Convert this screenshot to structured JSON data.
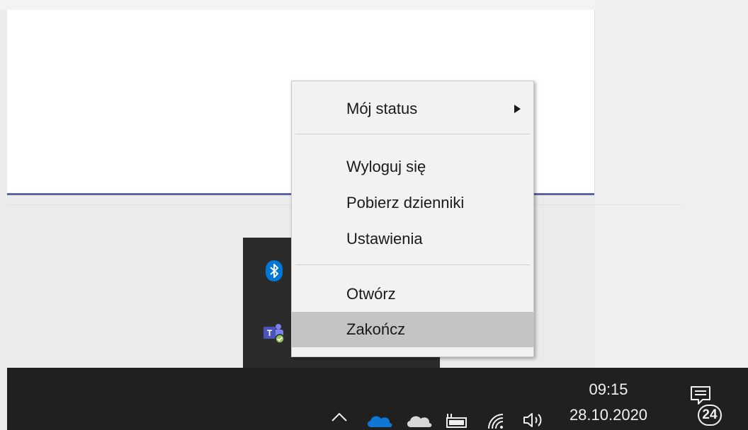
{
  "context_menu": {
    "items": [
      {
        "label": "Mój status",
        "has_submenu": true
      },
      {
        "label": "Wyloguj się"
      },
      {
        "label": "Pobierz dzienniki"
      },
      {
        "label": "Ustawienia"
      },
      {
        "label": "Otwórz"
      },
      {
        "label": "Zakończ",
        "highlighted": true
      }
    ]
  },
  "tray_overflow": {
    "icons": [
      "bluetooth-icon",
      "teams-icon"
    ]
  },
  "taskbar": {
    "tray_icons": [
      "chevron-up-icon",
      "onedrive-blue-icon",
      "onedrive-gray-icon",
      "battery-icon",
      "wifi-icon",
      "speaker-icon"
    ],
    "clock": {
      "time": "09:15",
      "date": "28.10.2020"
    },
    "notifications": {
      "count": "24"
    }
  },
  "colors": {
    "accent": "#6264a7",
    "taskbar": "#202020",
    "onedrive_blue": "#0f78d4",
    "bluetooth_blue": "#0078d7",
    "menu_highlight": "#c4c4c4"
  }
}
